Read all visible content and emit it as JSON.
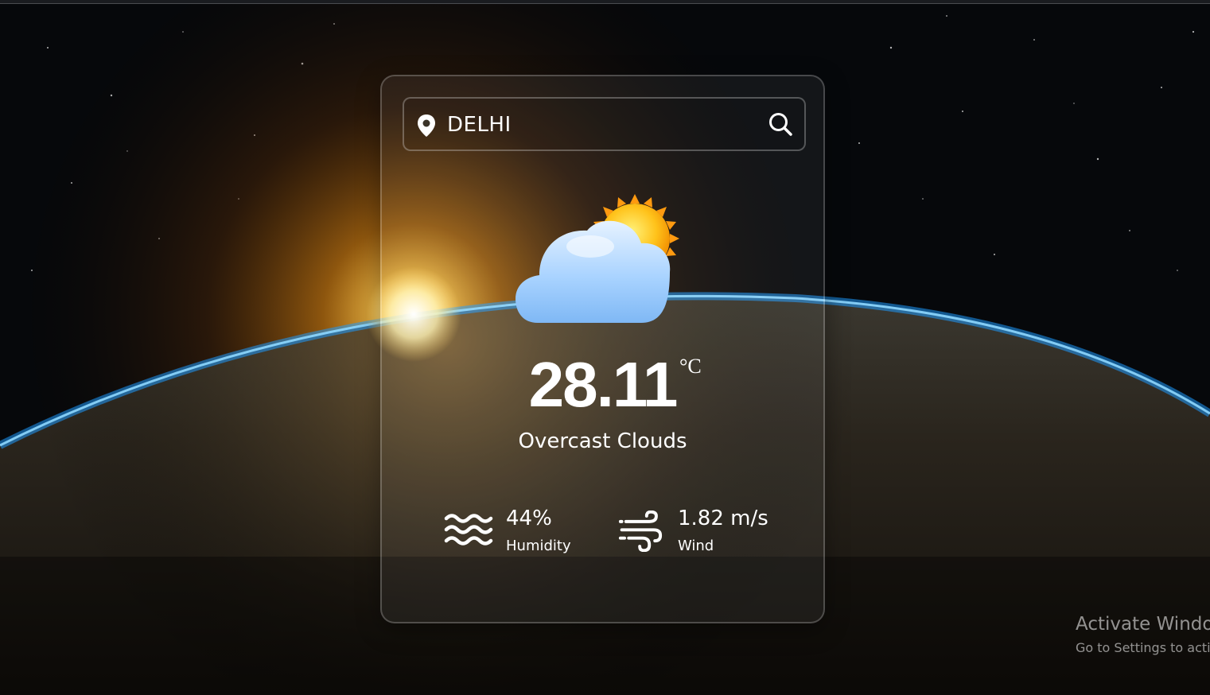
{
  "search": {
    "value": "DELHI",
    "pin_icon": "map-pin-icon",
    "search_icon": "search-icon"
  },
  "weather": {
    "icon": "cloud-sun-icon",
    "temperature": "28.11",
    "unit": "°C",
    "description": "Overcast Clouds"
  },
  "humidity": {
    "value": "44%",
    "label": "Humidity",
    "icon": "waves-icon"
  },
  "wind": {
    "value": "1.82 m/s",
    "label": "Wind",
    "icon": "wind-icon"
  },
  "os_watermark": {
    "title": "Activate Windo",
    "subtitle": "Go to Settings to acti"
  },
  "colors": {
    "atmosphere": "#1e9bff",
    "sun_glow": "#ffb020",
    "text": "#ffffff"
  }
}
